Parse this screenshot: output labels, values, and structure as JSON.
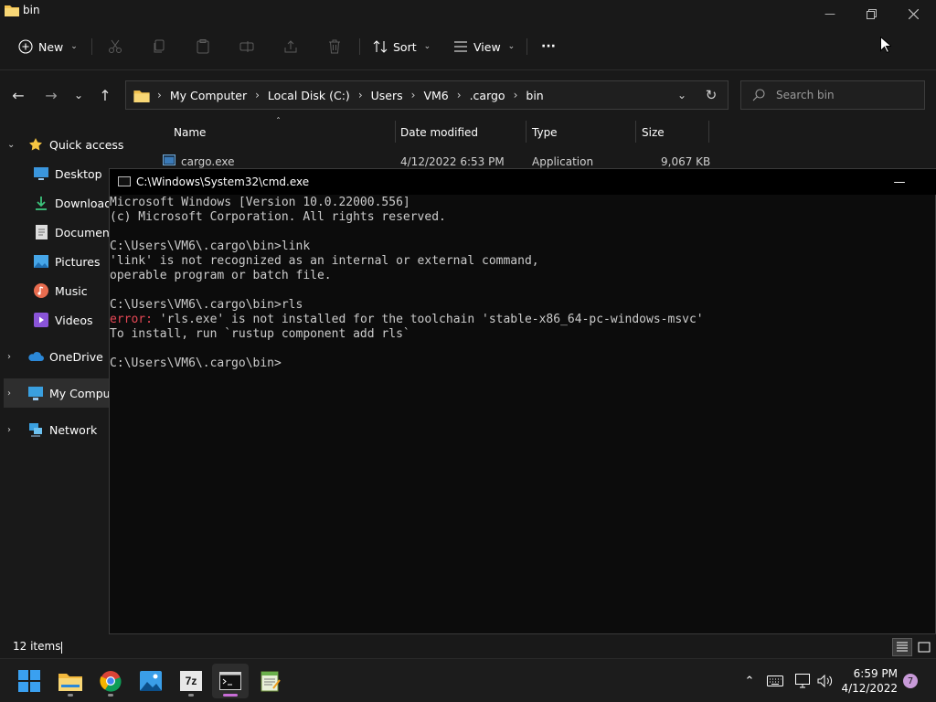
{
  "explorer": {
    "window_title": "bin",
    "toolbar": {
      "new_label": "New",
      "sort_label": "Sort",
      "view_label": "View",
      "more_label": "···"
    },
    "breadcrumb": [
      "My Computer",
      "Local Disk (C:)",
      "Users",
      "VM6",
      ".cargo",
      "bin"
    ],
    "search_placeholder": "Search bin",
    "nav": {
      "quick_access": "Quick access",
      "desktop": "Desktop",
      "downloads": "Downloads",
      "documents": "Documents",
      "pictures": "Pictures",
      "music": "Music",
      "videos": "Videos",
      "onedrive": "OneDrive",
      "my_computer": "My Computer",
      "network": "Network"
    },
    "columns": {
      "name": "Name",
      "date_modified": "Date modified",
      "type": "Type",
      "size": "Size"
    },
    "files": [
      {
        "name": "cargo.exe",
        "date": "4/12/2022 6:53 PM",
        "type": "Application",
        "size": "9,067 KB"
      }
    ],
    "status_items": "12 items"
  },
  "cmd": {
    "title": "C:\\Windows\\System32\\cmd.exe",
    "lines": {
      "l1": "Microsoft Windows [Version 10.0.22000.556]",
      "l2": "(c) Microsoft Corporation. All rights reserved.",
      "l3": "C:\\Users\\VM6\\.cargo\\bin>link",
      "l4": "'link' is not recognized as an internal or external command,",
      "l5": "operable program or batch file.",
      "l6": "C:\\Users\\VM6\\.cargo\\bin>rls",
      "l7_err": "error:",
      "l7_rest": " 'rls.exe' is not installed for the toolchain 'stable-x86_64-pc-windows-msvc'",
      "l8": "To install, run `rustup component add rls`",
      "l9": "C:\\Users\\VM6\\.cargo\\bin>"
    },
    "colors": {
      "error": "#e74856",
      "text": "#cccccc"
    }
  },
  "taskbar": {
    "apps": [
      "start-icon",
      "file-explorer-icon",
      "chrome-icon",
      "photos-icon",
      "7zip-icon",
      "cmd-icon",
      "notepad-icon"
    ],
    "seven_zip_label": "7z",
    "time": "6:59 PM",
    "date": "4/12/2022",
    "notification_count": "7"
  }
}
